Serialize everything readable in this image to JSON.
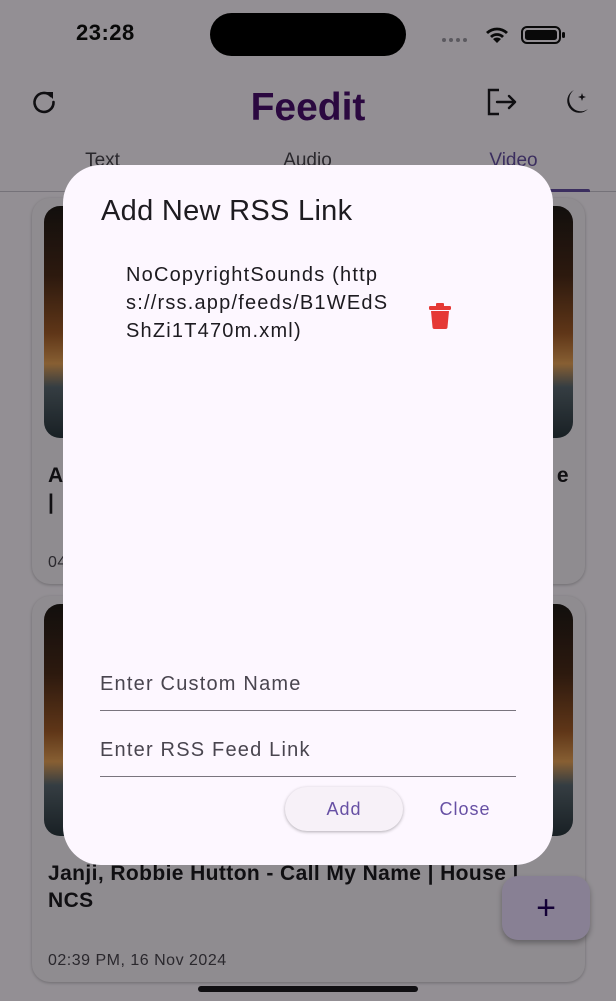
{
  "status_bar": {
    "time": "23:28"
  },
  "app_bar": {
    "title": "Feedit"
  },
  "tabs": [
    {
      "label": "Text",
      "active": false
    },
    {
      "label": "Audio",
      "active": false
    },
    {
      "label": "Video",
      "active": true
    }
  ],
  "feed": {
    "items": [
      {
        "title_visible_prefix": "A",
        "title_visible_line2": "|",
        "title_visible_suffix": "e",
        "date_visible_prefix": "04"
      },
      {
        "title": "Janji, Robbie Hutton - Call My Name | House | NCS",
        "date": "02:39 PM, 16 Nov 2024"
      }
    ]
  },
  "fab": {
    "label": "+"
  },
  "dialog": {
    "title": "Add New RSS Link",
    "rss_links": [
      {
        "text": "NoCopyrightSounds (https://rss.app/feeds/B1WEdSShZi1T470m.xml)"
      }
    ],
    "name_field": {
      "placeholder": "Enter Custom Name",
      "value": ""
    },
    "link_field": {
      "placeholder": "Enter RSS Feed Link",
      "value": ""
    },
    "add_label": "Add",
    "close_label": "Close"
  },
  "colors": {
    "brand": "#4a0e6e",
    "accent": "#6750a4",
    "delete": "#e53935",
    "surface": "#fdf7ff"
  }
}
